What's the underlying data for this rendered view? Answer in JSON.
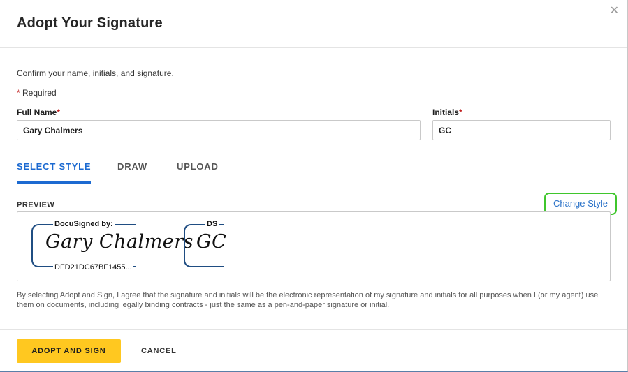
{
  "dialog": {
    "title": "Adopt Your Signature",
    "close_icon": "close-icon"
  },
  "form": {
    "intro": "Confirm your name, initials, and signature.",
    "required_mark": "*",
    "required_text": " Required",
    "full_name_label": "Full Name",
    "full_name_value": "Gary Chalmers",
    "initials_label": "Initials",
    "initials_value": "GC"
  },
  "tabs": [
    {
      "label": "SELECT STYLE",
      "active": true
    },
    {
      "label": "DRAW",
      "active": false
    },
    {
      "label": "UPLOAD",
      "active": false
    }
  ],
  "preview": {
    "label": "PREVIEW",
    "change_style": "Change Style",
    "signature": {
      "header": "DocuSigned by:",
      "script": "Gary Chalmers",
      "id": "DFD21DC67BF1455..."
    },
    "initials": {
      "header": "DS",
      "script": "GC"
    }
  },
  "disclaimer": "By selecting Adopt and Sign, I agree that the signature and initials will be the electronic representation of my signature and initials for all purposes when I (or my agent) use them on documents, including legally binding contracts - just the same as a pen-and-paper signature or initial.",
  "footer": {
    "adopt_label": "ADOPT AND SIGN",
    "cancel_label": "CANCEL"
  },
  "colors": {
    "accent": "#1c6ad1",
    "primary_button": "#ffc820",
    "highlight": "#3fc62c",
    "signature_frame": "#1f4d82",
    "required": "#c01d1d"
  }
}
